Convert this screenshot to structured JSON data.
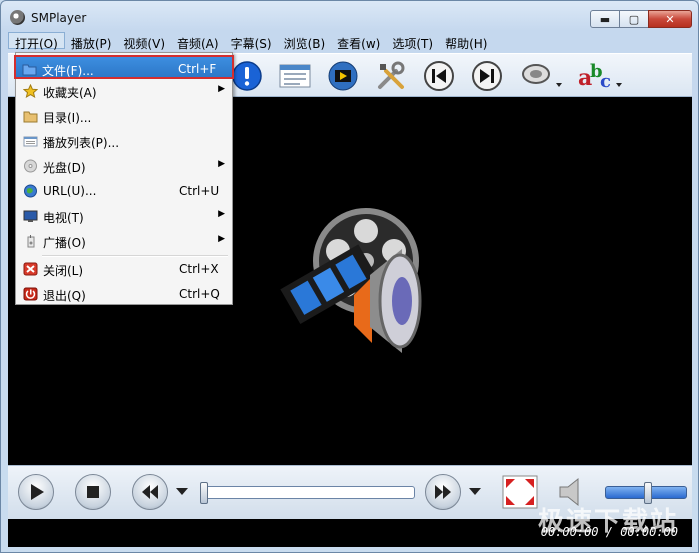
{
  "window": {
    "title": "SMPlayer",
    "min_glyph": "▬",
    "max_glyph": "▢",
    "close_glyph": "✕"
  },
  "menubar": {
    "items": [
      {
        "label": "打开(O)"
      },
      {
        "label": "播放(P)"
      },
      {
        "label": "视频(V)"
      },
      {
        "label": "音频(A)"
      },
      {
        "label": "字幕(S)"
      },
      {
        "label": "浏览(B)"
      },
      {
        "label": "查看(w)"
      },
      {
        "label": "选项(T)"
      },
      {
        "label": "帮助(H)"
      }
    ]
  },
  "open_menu": {
    "items": [
      {
        "label": "文件(F)...",
        "shortcut": "Ctrl+F",
        "icon": "folder-icon",
        "highlighted": true
      },
      {
        "label": "收藏夹(A)",
        "shortcut": "",
        "icon": "star-icon",
        "submenu": true
      },
      {
        "label": "目录(I)...",
        "shortcut": "",
        "icon": "folder-open-icon"
      },
      {
        "label": "播放列表(P)...",
        "shortcut": "",
        "icon": "playlist-icon"
      },
      {
        "label": "光盘(D)",
        "shortcut": "",
        "icon": "disc-icon",
        "submenu": true
      },
      {
        "label": "URL(U)...",
        "shortcut": "Ctrl+U",
        "icon": "globe-icon"
      },
      {
        "label": "电视(T)",
        "shortcut": "",
        "icon": "tv-icon",
        "submenu": true
      },
      {
        "label": "广播(O)",
        "shortcut": "",
        "icon": "radio-icon",
        "submenu": true
      },
      {
        "label": "关闭(L)",
        "shortcut": "Ctrl+X",
        "icon": "close-file-icon"
      },
      {
        "label": "退出(Q)",
        "shortcut": "Ctrl+Q",
        "icon": "quit-icon"
      }
    ],
    "submenu_glyph": "▶"
  },
  "status": {
    "time": "00:00:00 / 00:00:00"
  },
  "watermark": {
    "text": "极速下载站"
  },
  "colors": {
    "highlight": "#2d78c8",
    "highlight_border": "#d42e2e",
    "video_bg": "#000000"
  }
}
